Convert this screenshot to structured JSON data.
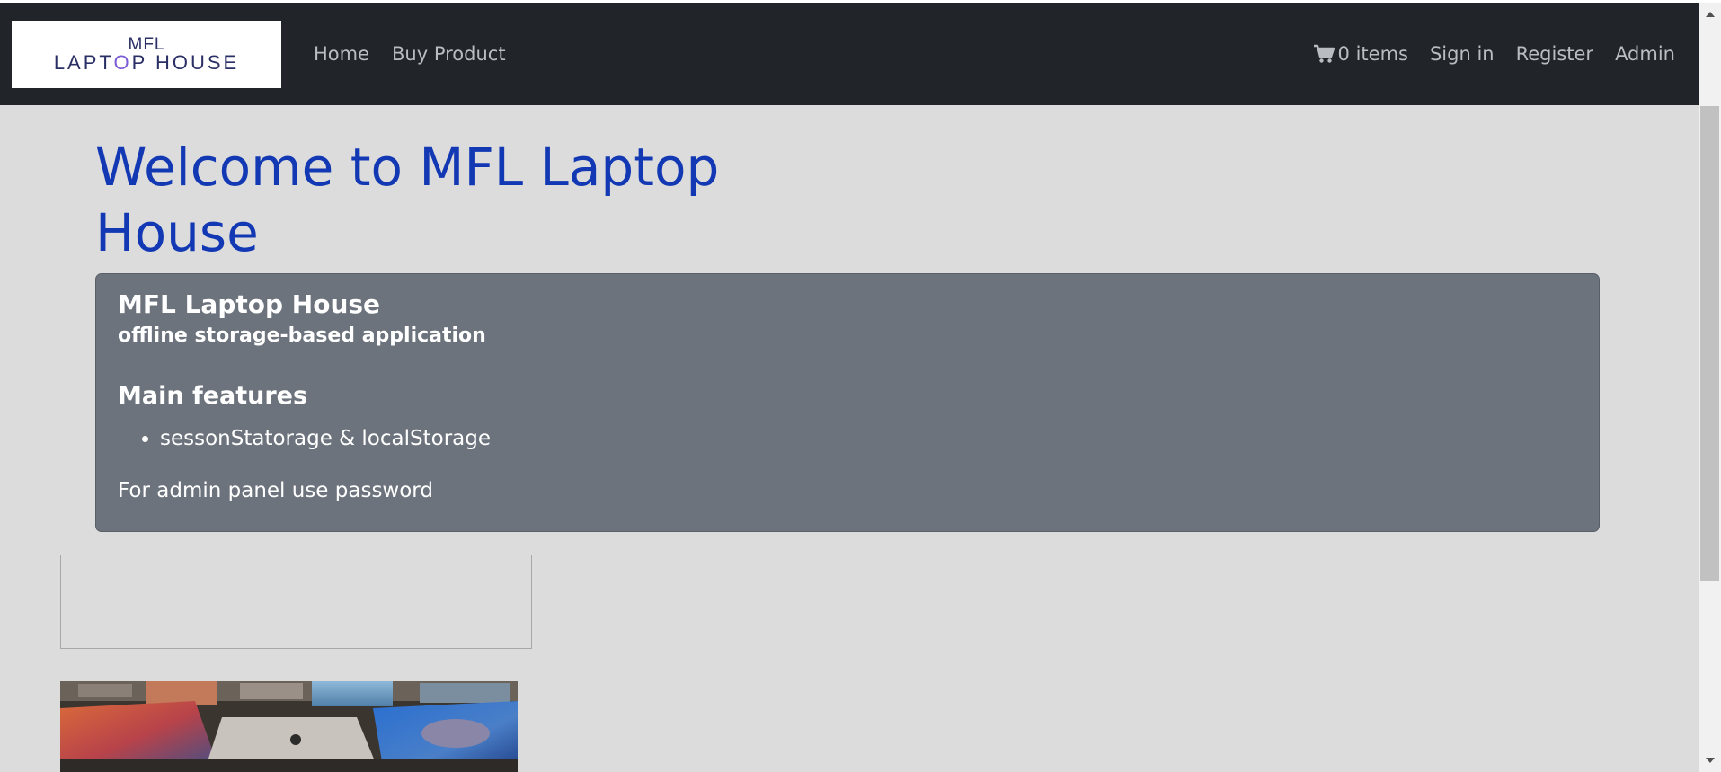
{
  "brand": {
    "logo_top": "MFL",
    "logo_bottom_left": "LAPT",
    "logo_bottom_o": "O",
    "logo_bottom_right": "P HOUSE"
  },
  "nav": {
    "home": "Home",
    "buy_product": "Buy Product",
    "cart_label": "0 items",
    "sign_in": "Sign in",
    "register": "Register",
    "admin": "Admin"
  },
  "icons": {
    "cart": "shopping-cart-icon",
    "scroll_up": "triangle-up-icon",
    "scroll_down": "triangle-down-icon"
  },
  "main": {
    "headline_line1": "Welcome to MFL Laptop",
    "headline_line2": "House",
    "card": {
      "title": "MFL Laptop House",
      "subtitle": "offline storage-based application",
      "features_title": "Main features",
      "features": [
        "sessonStatorage & localStorage"
      ],
      "admin_note": "For admin panel use password"
    }
  },
  "colors": {
    "navbar_bg": "#212529",
    "nav_link": "#b9bcc0",
    "headline": "#1238b4",
    "card_bg": "#6c737c",
    "page_bg": "#dcdcdc"
  }
}
